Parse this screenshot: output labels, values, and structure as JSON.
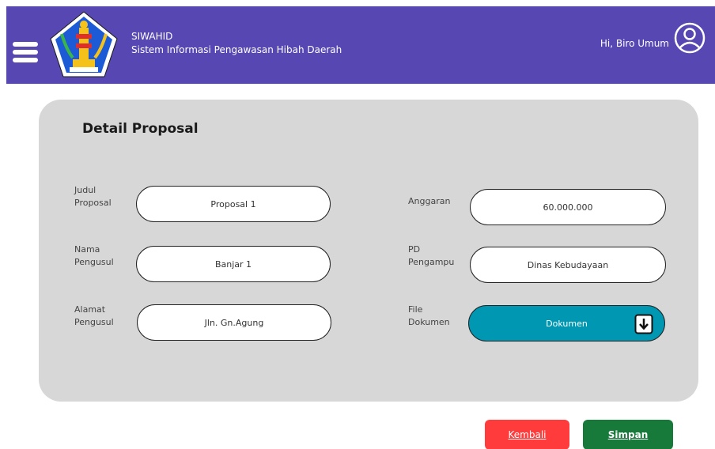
{
  "header": {
    "app_name": "SIWAHID",
    "app_subtitle": "Sistem Informasi Pengawasan Hibah Daerah",
    "greeting": "Hi, Biro Umum",
    "menu_icon": "hamburger-icon",
    "user_icon": "user-circle-icon",
    "logo": "bali-province-emblem"
  },
  "card": {
    "title": "Detail Proposal",
    "fields": {
      "judul": {
        "label_line1": "Judul",
        "label_line2": "Proposal",
        "value": "Proposal 1"
      },
      "nama": {
        "label_line1": "Nama",
        "label_line2": "Pengusul",
        "value": "Banjar 1"
      },
      "alamat": {
        "label_line1": "Alamat",
        "label_line2": "Pengusul",
        "value": "Jln. Gn.Agung"
      },
      "anggaran": {
        "label_line1": "Anggaran",
        "value": "60.000.000"
      },
      "pd": {
        "label_line1": "PD",
        "label_line2": "Pengampu",
        "value": "Dinas Kebudayaan"
      },
      "file": {
        "label_line1": "File",
        "label_line2": "Dokumen",
        "value": "Dokumen",
        "icon": "download-icon"
      }
    }
  },
  "actions": {
    "back_label": "Kembali",
    "save_label": "Simpan"
  },
  "colors": {
    "header_bg": "#5647b3",
    "card_bg": "#d7d7d7",
    "file_button": "#0097b2",
    "back_button": "#ff3b3b",
    "save_button": "#177a3a"
  }
}
